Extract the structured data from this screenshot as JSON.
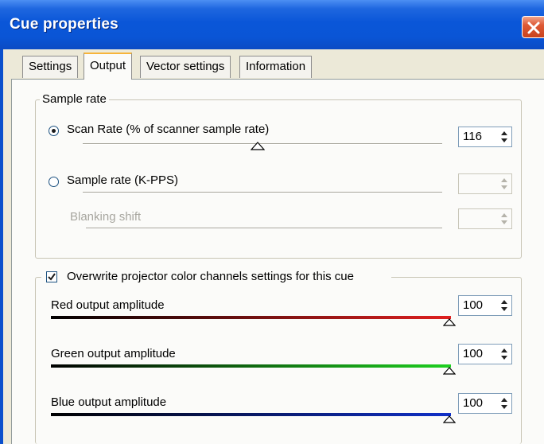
{
  "window": {
    "title": "Cue properties"
  },
  "tabs": [
    {
      "label": "Settings",
      "active": false
    },
    {
      "label": "Output",
      "active": true
    },
    {
      "label": "Vector settings",
      "active": false
    },
    {
      "label": "Information",
      "active": false
    }
  ],
  "sample_rate": {
    "group_label": "Sample rate",
    "scan_rate": {
      "label": "Scan Rate (% of scanner sample rate)",
      "selected": true,
      "value": "116"
    },
    "sample_rate_kpps": {
      "label": "Sample rate (K-PPS)",
      "selected": false,
      "value": ""
    },
    "blanking_shift": {
      "label": "Blanking shift",
      "enabled": false,
      "value": ""
    }
  },
  "color_channels": {
    "overwrite_label": "Overwrite projector color channels settings for this cue",
    "overwrite_checked": true,
    "red": {
      "label": "Red output amplitude",
      "value": "100",
      "color": "#e02020"
    },
    "green": {
      "label": "Green output amplitude",
      "value": "100",
      "color": "#1ed020"
    },
    "blue": {
      "label": "Blue output amplitude",
      "value": "100",
      "color": "#1030c8"
    }
  },
  "colors": {
    "titlebar": "#0a55d6",
    "close_button": "#d9532c",
    "dialog_bg": "#ece9d8",
    "panel_bg": "#fbfbf9"
  }
}
